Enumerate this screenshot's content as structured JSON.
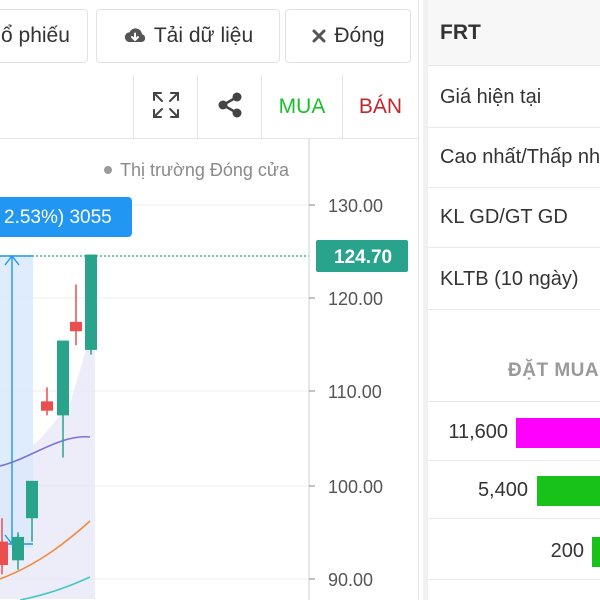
{
  "toolbar": {
    "stock_label": "ổ phiếu",
    "download_label": "Tải dữ liệu",
    "close_label": "Đóng"
  },
  "chart_toolbar": {
    "buy_label": "MUA",
    "sell_label": "BÁN"
  },
  "chart_data": {
    "type": "candlestick",
    "market_status": "Thị trường Đóng cửa",
    "price_labels": [
      "130.00",
      "120.00",
      "110.00",
      "100.00",
      "90.00"
    ],
    "ylim": [
      88,
      138
    ],
    "current_price": "124.70",
    "current_price_value": 124.7,
    "measure_label": "2.53%) 3055",
    "candles": [
      {
        "o": 94.0,
        "h": 96.5,
        "l": 90.5,
        "c": 91.5,
        "dir": "down"
      },
      {
        "o": 92.0,
        "h": 95.0,
        "l": 91.0,
        "c": 94.5,
        "dir": "up"
      },
      {
        "o": 96.5,
        "h": 97.5,
        "l": 94.0,
        "c": 100.5,
        "dir": "up"
      },
      {
        "o": 109.0,
        "h": 110.5,
        "l": 107.5,
        "c": 108.0,
        "dir": "down"
      },
      {
        "o": 107.5,
        "h": 108.5,
        "l": 103.0,
        "c": 115.5,
        "dir": "up"
      },
      {
        "o": 117.5,
        "h": 121.5,
        "l": 115.0,
        "c": 116.5,
        "dir": "down"
      },
      {
        "o": 114.5,
        "h": 124.7,
        "l": 114.0,
        "c": 124.7,
        "dir": "up"
      }
    ],
    "colors": {
      "up": "#2aa38c",
      "down": "#ea4e4e",
      "ma_short": "#7c72d8",
      "ma_mid": "#f28a3c",
      "ma_long": "#45c8c2",
      "label_bg": "#2196f3",
      "price_tag": "#2aa38c"
    }
  },
  "info_panel": {
    "symbol": "FRT",
    "rows": [
      {
        "label": "Giá hiện tại"
      },
      {
        "label": "Cao nhất/Thấp nhất"
      },
      {
        "label": "KL GD/GT GD"
      },
      {
        "label": "KLTB (10 ngày)"
      }
    ]
  },
  "order_book": {
    "header": "ĐẶT MUA",
    "bids": [
      {
        "qty": "11,600",
        "color": "#ff00ff"
      },
      {
        "qty": "5,400",
        "color": "#19c219"
      },
      {
        "qty": "200",
        "color": "#19c219"
      }
    ]
  }
}
